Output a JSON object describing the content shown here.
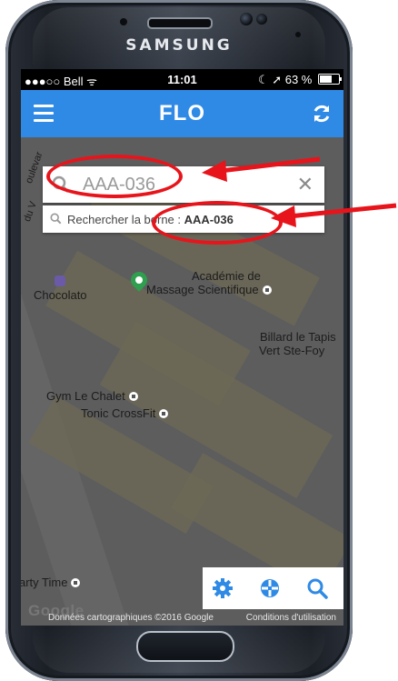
{
  "device": {
    "brand": "SAMSUNG"
  },
  "status_bar": {
    "carrier": "●●●○○ Bell ᯤ",
    "time": "11:01",
    "right": "☾ ➚ 63 %",
    "battery_level_percent": 63
  },
  "app_bar": {
    "title": "FLO",
    "menu_icon": "menu-icon",
    "refresh_icon": "refresh-icon"
  },
  "search": {
    "value": "AAA-036",
    "placeholder": "",
    "clear_glyph": "✕"
  },
  "suggestion": {
    "prefix": "Rechercher la borne : ",
    "code": "AAA-036"
  },
  "map": {
    "labels": {
      "chocolato": "Chocolato",
      "academie_1": "Académie de",
      "academie_2": "Massage Scientifique",
      "billard_1": "Billard le Tapis",
      "billard_2": "Vert Ste-Foy",
      "gym": "Gym Le Chalet",
      "tonic": "Tonic CrossFit",
      "party": "arty Time",
      "street": "oulevar",
      "street2": "du V"
    },
    "footer": {
      "logo": "Google",
      "data_text": "Données cartographiques ©2016 Google",
      "terms": "Conditions d'utilisation"
    }
  },
  "toolbar": {
    "icons": [
      "gear-icon",
      "crosshair-icon",
      "search-icon"
    ]
  },
  "colors": {
    "app_bar": "#2f8ae6",
    "accent": "#2f8ae6",
    "annotation": "#e8141b"
  }
}
